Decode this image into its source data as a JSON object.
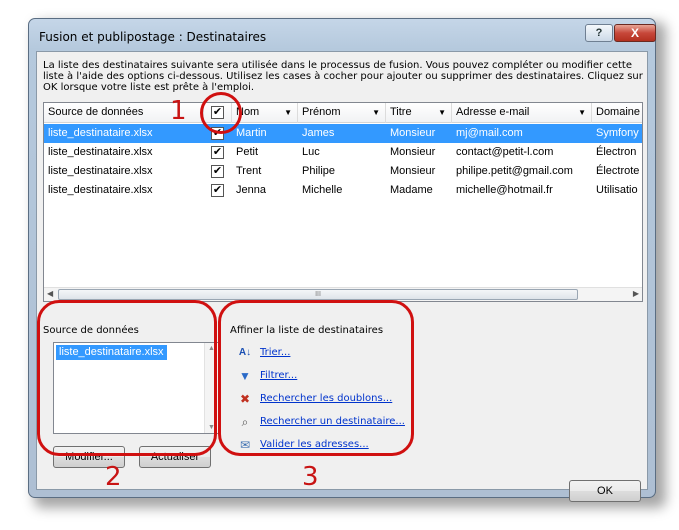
{
  "window": {
    "title": "Fusion et publipostage : Destinataires",
    "help_label": "?",
    "close_label": "X"
  },
  "description": "La liste des destinataires suivante sera utilisée dans le processus de fusion. Vous pouvez compléter ou modifier cette liste à l'aide des options ci-dessous. Utilisez les cases à cocher pour ajouter ou supprimer des destinataires. Cliquez sur OK lorsque votre liste est prête à l'emploi.",
  "table": {
    "columns": [
      "Source de données",
      "",
      "Nom",
      "Prénom",
      "Titre",
      "Adresse e-mail",
      "Domaine"
    ],
    "header_checkbox": "✔",
    "rows": [
      {
        "source": "liste_destinataire.xlsx",
        "checked": "✔",
        "nom": "Martin",
        "prenom": "James",
        "titre": "Monsieur",
        "email": "mj@mail.com",
        "domaine": "Symfony"
      },
      {
        "source": "liste_destinataire.xlsx",
        "checked": "✔",
        "nom": "Petit",
        "prenom": "Luc",
        "titre": "Monsieur",
        "email": "contact@petit-l.com",
        "domaine": "Électron"
      },
      {
        "source": "liste_destinataire.xlsx",
        "checked": "✔",
        "nom": "Trent",
        "prenom": "Philipe",
        "titre": "Monsieur",
        "email": "philipe.petit@gmail.com",
        "domaine": "Électrote"
      },
      {
        "source": "liste_destinataire.xlsx",
        "checked": "✔",
        "nom": "Jenna",
        "prenom": "Michelle",
        "titre": "Madame",
        "email": "michelle@hotmail.fr",
        "domaine": "Utilisatio"
      }
    ],
    "scroll_grip": "III"
  },
  "sources": {
    "label": "Source de données",
    "items": [
      "liste_destinataire.xlsx"
    ],
    "modify_button": "Modifier...",
    "refresh_button": "Actualiser"
  },
  "refine": {
    "label": "Affiner la liste de destinataires",
    "links": [
      "Trier...",
      "Filtrer...",
      "Rechercher les doublons...",
      "Rechercher un destinataire...",
      "Valider les adresses..."
    ]
  },
  "ok_button": "OK",
  "annotations": {
    "one": "1",
    "two": "2",
    "three": "3"
  },
  "colors": {
    "selection": "#3399ff",
    "annotation": "#d01010",
    "link": "#0033cc"
  }
}
